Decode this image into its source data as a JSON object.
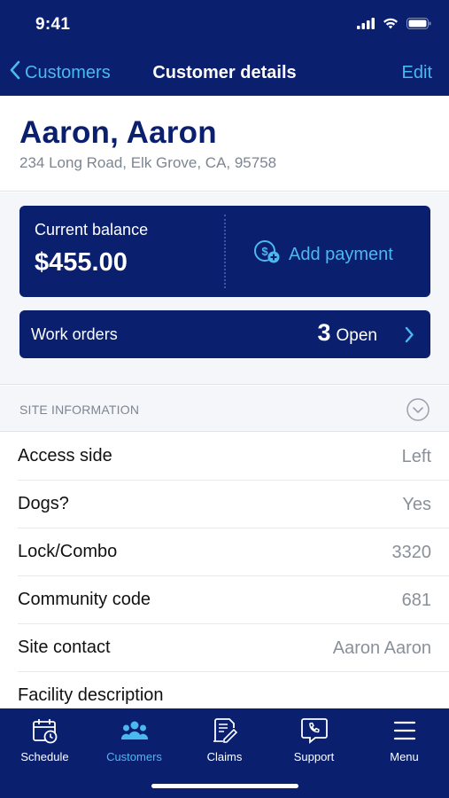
{
  "status": {
    "time": "9:41"
  },
  "nav": {
    "back_label": "Customers",
    "title": "Customer details",
    "edit_label": "Edit"
  },
  "customer": {
    "name": "Aaron, Aaron",
    "address": "234 Long Road, Elk Grove, CA, 95758"
  },
  "balance": {
    "label": "Current balance",
    "amount": "$455.00",
    "add_payment_label": "Add payment"
  },
  "work_orders": {
    "label": "Work orders",
    "count": "3",
    "status": "Open"
  },
  "site_info": {
    "title": "SITE INFORMATION",
    "rows": [
      {
        "label": "Access side",
        "value": "Left"
      },
      {
        "label": "Dogs?",
        "value": "Yes"
      },
      {
        "label": "Lock/Combo",
        "value": "3320"
      },
      {
        "label": "Community code",
        "value": "681"
      },
      {
        "label": "Site contact",
        "value": "Aaron Aaron"
      },
      {
        "label": "Facility description",
        "value": ""
      }
    ]
  },
  "tabs": [
    {
      "label": "Schedule",
      "icon": "calendar-clock-icon",
      "active": false
    },
    {
      "label": "Customers",
      "icon": "people-icon",
      "active": true
    },
    {
      "label": "Claims",
      "icon": "document-icon",
      "active": false
    },
    {
      "label": "Support",
      "icon": "phone-chat-icon",
      "active": false
    },
    {
      "label": "Menu",
      "icon": "hamburger-icon",
      "active": false
    }
  ],
  "colors": {
    "primary": "#0a1f6e",
    "accent": "#4cb8f0"
  }
}
